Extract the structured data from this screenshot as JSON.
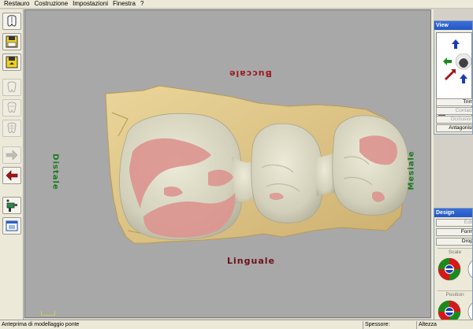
{
  "menu": {
    "items": [
      "Restauro",
      "Costruzione",
      "Impostazioni",
      "Finestra",
      "?"
    ]
  },
  "toolbar": {
    "icons": [
      "tooth-arch-icon",
      "save-yellow-icon",
      "save-export-icon",
      "tooth-outline-icon",
      "tooth-outline-alt-icon",
      "tooth-grid-icon",
      "arrow-right-icon",
      "arrow-left-icon",
      "paint-gun-icon",
      "window-preview-icon"
    ]
  },
  "viewport": {
    "labels": {
      "buccale": "Buccale",
      "linguale": "Linguale",
      "distale": "Distale",
      "mesiale": "Mesiale"
    },
    "colors": {
      "background": "#a8a8a8",
      "crown": "#d8d6c0",
      "contact_zone": "#dc9590",
      "gypsum": "#e0c888"
    }
  },
  "view_panel": {
    "title": "View",
    "buttons": {
      "trim": "Trim",
      "contact": "Contact",
      "occlusion": "Occlusion",
      "antagonist": "Antagonist"
    }
  },
  "design_panel": {
    "title": "Design",
    "buttons": {
      "edit": "Edit",
      "form": "Form",
      "drop": "Drop"
    },
    "groups": {
      "scale": "Scale",
      "position": "Position"
    }
  },
  "statusbar": {
    "message": "Anteprima di modellaggio ponte",
    "thickness_label": "Spessore:",
    "height_label": "Altezza"
  }
}
